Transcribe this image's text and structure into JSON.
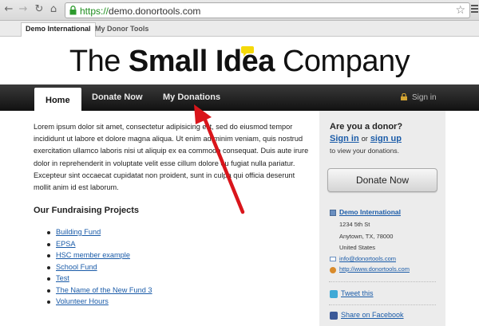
{
  "browser": {
    "url_scheme": "https://",
    "url_host": "demo.donortools.com"
  },
  "site_tabs": [
    "Demo International",
    "My Donor Tools"
  ],
  "logo": {
    "part1": "The ",
    "part2": "Small Idea",
    "part3": " Company"
  },
  "mainnav": {
    "home": "Home",
    "donate": "Donate Now",
    "my_donations": "My Donations",
    "sign_in": "Sign in"
  },
  "content": {
    "lorem": "Lorem ipsum dolor sit amet, consectetur adipisicing elit, sed do eiusmod tempor incididunt ut labore et dolore magna aliqua. Ut enim ad minim veniam, quis nostrud exercitation ullamco laboris nisi ut aliquip ex ea commodo consequat. Duis aute irure dolor in reprehenderit in voluptate velit esse cillum dolore eu fugiat nulla pariatur. Excepteur sint occaecat cupidatat non proident, sunt in culpa qui officia deserunt mollit anim id est laborum.",
    "projects_heading": "Our Fundraising Projects",
    "projects": [
      "Building Fund",
      "EPSA",
      "HSC member example",
      "School Fund",
      "Test",
      "The Name of the New Fund 3",
      "Volunteer Hours"
    ]
  },
  "sidebar": {
    "question": "Are you a donor?",
    "sign_in": "Sign in",
    "or": "or",
    "sign_up": "sign up",
    "view": "to view your donations.",
    "donate_button": "Donate Now",
    "org_name": "Demo International",
    "address1": "1234 5th St",
    "address2": "Anytown, TX, 78000",
    "address3": "United States",
    "email": "info@donortools.com",
    "website": "http://www.donortools.com",
    "tweet": "Tweet this",
    "share": "Share on Facebook"
  },
  "colors": {
    "link": "#1a5ba8",
    "nav_bg": "#1a1a1a",
    "sidebar_bg": "#ececec",
    "annotation_arrow": "#d9151b"
  }
}
